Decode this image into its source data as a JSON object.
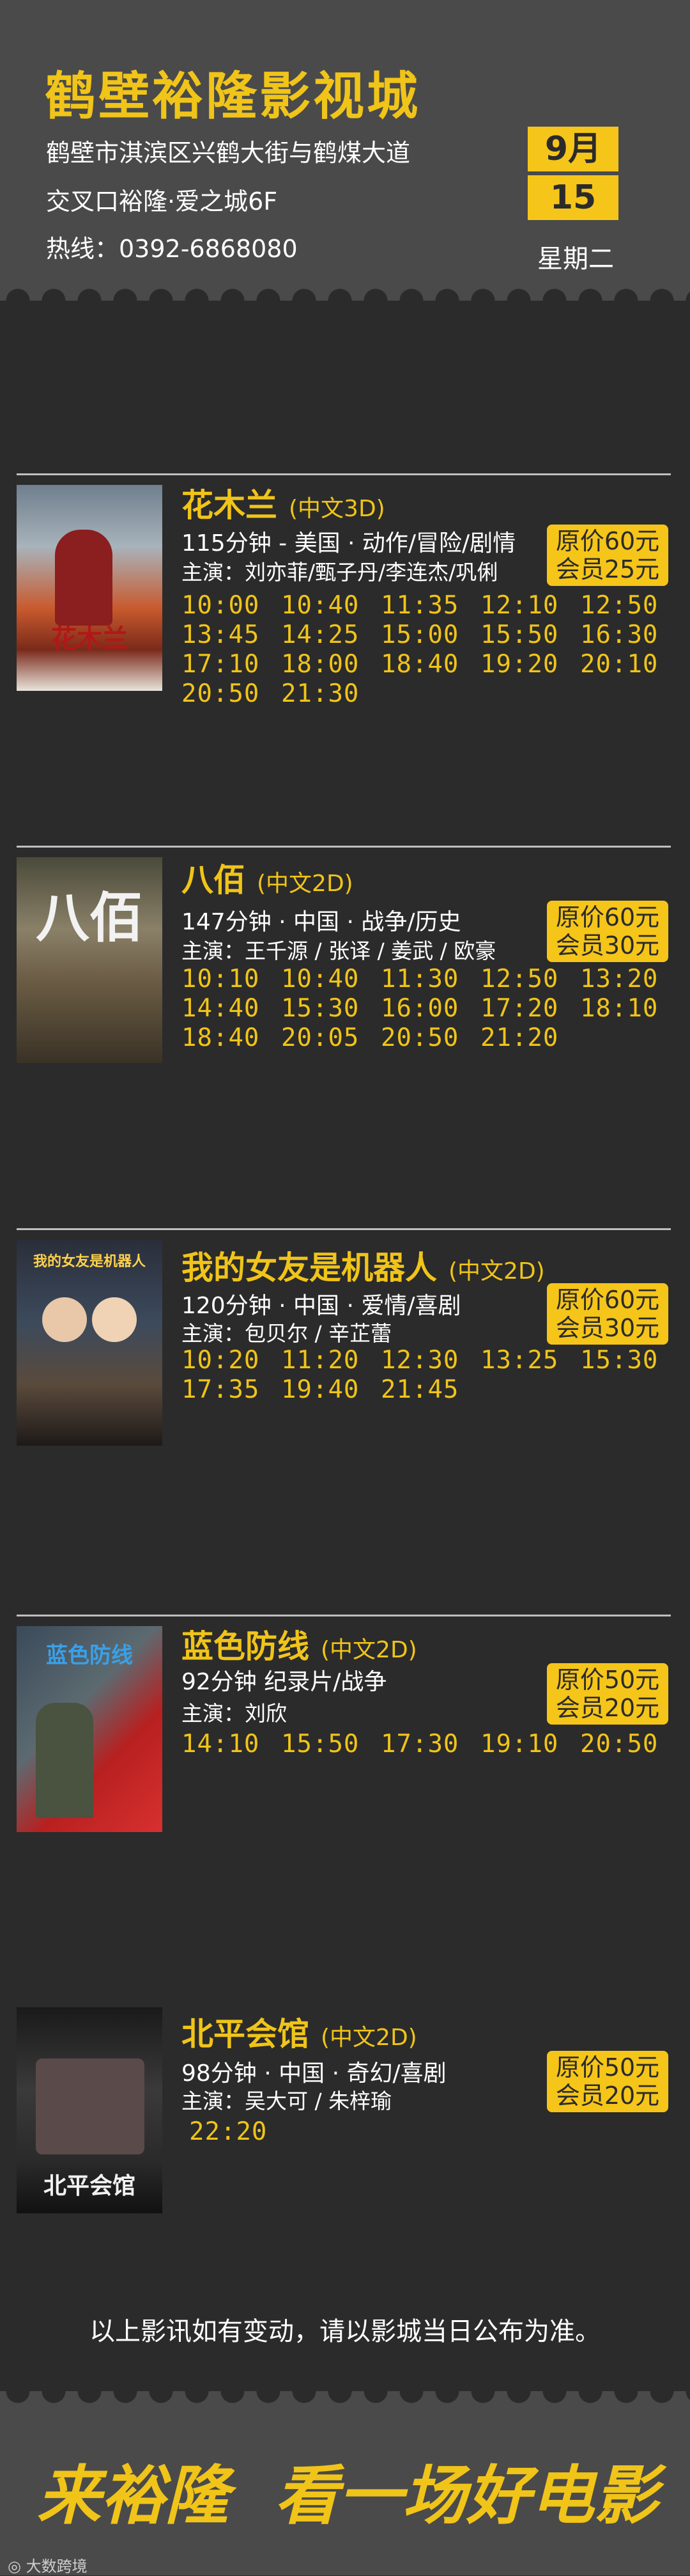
{
  "header": {
    "cinema_name": "鹤壁裕隆影视城",
    "address_line1": "鹤壁市淇滨区兴鹤大街与鹤煤大道",
    "address_line2": "交叉口裕隆·爱之城6F",
    "hotline": "热线：0392-6868080",
    "month": "9月",
    "day": "15",
    "weekday": "星期二"
  },
  "movies": [
    {
      "title": "花木兰",
      "format": "(中文3D)",
      "info": "115分钟 - 美国 · 动作/冒险/剧情",
      "cast": "主演：刘亦菲/甄子丹/李连杰/巩俐",
      "price_orig": "原价60元",
      "price_member": "会员25元",
      "poster_text": "花木兰",
      "times": [
        "10:00",
        "10:40",
        "11:35",
        "12:10",
        "12:50",
        "13:45",
        "14:25",
        "15:00",
        "15:50",
        "16:30",
        "17:10",
        "18:00",
        "18:40",
        "19:20",
        "20:10",
        "20:50",
        "21:30"
      ]
    },
    {
      "title": "八佰",
      "format": "(中文2D)",
      "info": "147分钟 · 中国 · 战争/历史",
      "cast": "主演：王千源 / 张译 / 姜武 / 欧豪",
      "price_orig": "原价60元",
      "price_member": "会员30元",
      "poster_text": "八佰",
      "times": [
        "10:10",
        "10:40",
        "11:30",
        "12:50",
        "13:20",
        "14:40",
        "15:30",
        "16:00",
        "17:20",
        "18:10",
        "18:40",
        "20:05",
        "20:50",
        "21:20"
      ]
    },
    {
      "title": "我的女友是机器人",
      "format": "(中文2D)",
      "info": "120分钟 · 中国 · 爱情/喜剧",
      "cast": "主演：包贝尔 / 辛芷蕾",
      "price_orig": "原价60元",
      "price_member": "会员30元",
      "poster_text": "我的女友是机器人",
      "times": [
        "10:20",
        "11:20",
        "12:30",
        "13:25",
        "15:30",
        "17:35",
        "19:40",
        "21:45"
      ]
    },
    {
      "title": "蓝色防线",
      "format": "(中文2D)",
      "info": "92分钟  纪录片/战争",
      "cast": "主演：刘欣",
      "price_orig": "原价50元",
      "price_member": "会员20元",
      "poster_text": "蓝色防线",
      "times": [
        "14:10",
        "15:50",
        "17:30",
        "19:10",
        "20:50"
      ]
    },
    {
      "title": "北平会馆",
      "format": "(中文2D)",
      "info": "98分钟 · 中国 · 奇幻/喜剧",
      "cast": "主演：吴大可 / 朱梓瑜",
      "price_orig": "原价50元",
      "price_member": "会员20元",
      "poster_text": "北平会馆",
      "times": [
        "22:20"
      ]
    }
  ],
  "notice": "以上影讯如有变动，请以影城当日公布为准。",
  "footer": {
    "slogan_left": "来裕隆",
    "slogan_right": "看一场好电影"
  },
  "watermark": "大数跨境",
  "colors": {
    "accent": "#f0c419",
    "background": "#2b2b2b",
    "header_bg": "#4a4a4a"
  }
}
